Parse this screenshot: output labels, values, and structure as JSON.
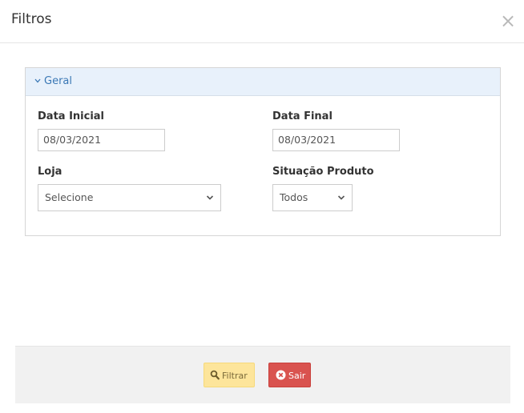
{
  "modal": {
    "title": "Filtros",
    "close_symbol": "×"
  },
  "panel": {
    "title": "Geral",
    "chevron_icon": "chevron-down-icon"
  },
  "fields": {
    "data_inicial": {
      "label": "Data Inicial",
      "value": "08/03/2021"
    },
    "data_final": {
      "label": "Data Final",
      "value": "08/03/2021"
    },
    "loja": {
      "label": "Loja",
      "selected": "Selecione"
    },
    "situacao_produto": {
      "label": "Situação Produto",
      "selected": "Todos"
    }
  },
  "footer": {
    "filtrar_label": "Filtrar",
    "filtrar_icon": "search-icon",
    "sair_label": "Sair",
    "sair_icon": "times-circle-icon"
  },
  "colors": {
    "panel_heading_bg": "#e8f1fb",
    "panel_title": "#3a78b5",
    "filtrar_bg": "#fde59b",
    "sair_bg": "#d9534f"
  }
}
